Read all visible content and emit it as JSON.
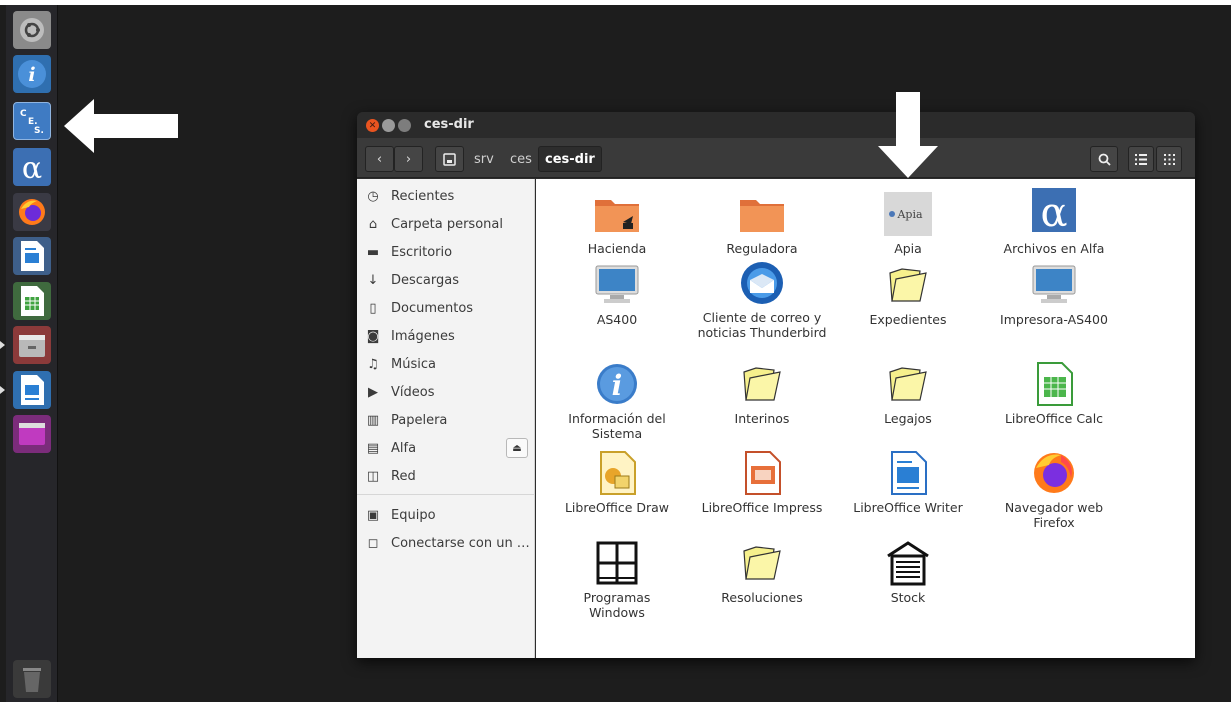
{
  "launcher": {
    "items": [
      {
        "name": "ubuntu-dash",
        "label": ""
      },
      {
        "name": "info",
        "glyph": "i"
      },
      {
        "name": "ces-app",
        "glyph": "C E S"
      },
      {
        "name": "alfa",
        "glyph": "α"
      },
      {
        "name": "firefox"
      },
      {
        "name": "libreoffice-writer"
      },
      {
        "name": "libreoffice-calc"
      },
      {
        "name": "file-manager"
      },
      {
        "name": "libreoffice-impress"
      },
      {
        "name": "terminal"
      },
      {
        "name": "trash"
      }
    ]
  },
  "window": {
    "title": "ces-dir",
    "breadcrumbs": [
      "srv",
      "ces",
      "ces-dir"
    ],
    "nav": {
      "back": "‹",
      "forward": "›"
    }
  },
  "sidebar": {
    "items": [
      {
        "icon": "clock-icon",
        "glyph": "◷",
        "label": "Recientes"
      },
      {
        "icon": "home-icon",
        "glyph": "⌂",
        "label": "Carpeta personal"
      },
      {
        "icon": "desktop-folder-icon",
        "glyph": "▬",
        "label": "Escritorio"
      },
      {
        "icon": "download-icon",
        "glyph": "↓",
        "label": "Descargas"
      },
      {
        "icon": "document-icon",
        "glyph": "▯",
        "label": "Documentos"
      },
      {
        "icon": "camera-icon",
        "glyph": "◙",
        "label": "Imágenes"
      },
      {
        "icon": "music-icon",
        "glyph": "♫",
        "label": "Música"
      },
      {
        "icon": "video-icon",
        "glyph": "▶",
        "label": "Vídeos"
      },
      {
        "icon": "trash-icon",
        "glyph": "▥",
        "label": "Papelera"
      },
      {
        "icon": "drive-icon",
        "glyph": "▤",
        "label": "Alfa"
      },
      {
        "icon": "network-icon",
        "glyph": "◫",
        "label": "Red"
      },
      {
        "icon": "computer-icon",
        "glyph": "▣",
        "label": "Equipo"
      },
      {
        "icon": "server-connect-icon",
        "glyph": "◻",
        "label": "Conectarse con un …"
      }
    ]
  },
  "files": [
    {
      "label": "Hacienda",
      "icon": "folder-orange-link"
    },
    {
      "label": "Reguladora",
      "icon": "folder-orange"
    },
    {
      "label": "Apia",
      "icon": "apia-logo",
      "logo_text": "Apia"
    },
    {
      "label": "Archivos en Alfa",
      "icon": "alpha"
    },
    {
      "label": "AS400",
      "icon": "monitor"
    },
    {
      "label": "Cliente de correo y noticias Thunderbird",
      "icon": "thunderbird"
    },
    {
      "label": "Expedientes",
      "icon": "folder-open-yellow"
    },
    {
      "label": "Impresora-AS400",
      "icon": "monitor"
    },
    {
      "label": "Información del Sistema",
      "icon": "info-circle"
    },
    {
      "label": "Interinos",
      "icon": "folder-open-yellow"
    },
    {
      "label": "Legajos",
      "icon": "folder-open-yellow"
    },
    {
      "label": "LibreOffice Calc",
      "icon": "lo-calc"
    },
    {
      "label": "LibreOffice Draw",
      "icon": "lo-draw"
    },
    {
      "label": "LibreOffice Impress",
      "icon": "lo-impress"
    },
    {
      "label": "LibreOffice Writer",
      "icon": "lo-writer"
    },
    {
      "label": "Navegador web Firefox",
      "icon": "firefox"
    },
    {
      "label": "Programas Windows",
      "icon": "window-frame"
    },
    {
      "label": "Resoluciones",
      "icon": "folder-open-yellow"
    },
    {
      "label": "Stock",
      "icon": "garage"
    }
  ],
  "colors": {
    "desktop": "#1d1d1d",
    "launcher": "#26262a",
    "toolbar": "#3a3a3a",
    "close": "#e95420",
    "folder_orange": "#f08a45",
    "folder_yellow": "#f4ee8a"
  }
}
